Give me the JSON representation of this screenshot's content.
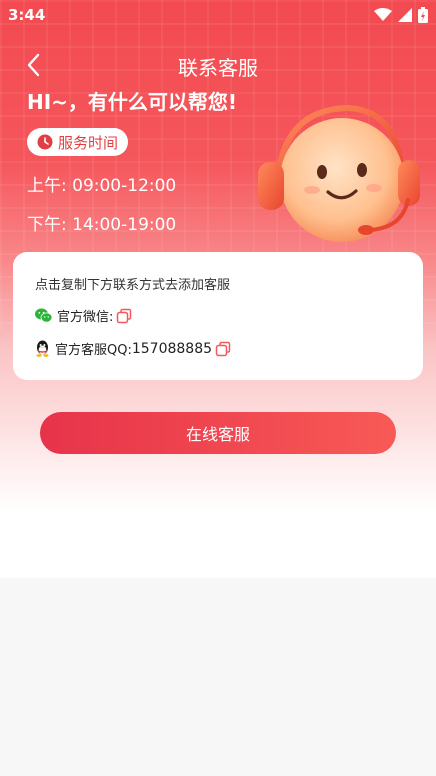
{
  "status_bar": {
    "time": "3:44"
  },
  "nav": {
    "title": "联系客服"
  },
  "greeting": "HI~，有什么可以帮您!",
  "service": {
    "badge": "服务时间",
    "morning": "上午: 09:00-12:00",
    "afternoon": "下午: 14:00-19:00"
  },
  "card": {
    "hint": "点击复制下方联系方式去添加客服",
    "wechat_label": "官方微信:",
    "wechat_value": "",
    "qq_label": "官方客服QQ:",
    "qq_value": "157088885"
  },
  "online_button": "在线客服",
  "colors": {
    "brand_red": "#f24a50",
    "button_start": "#e7334a",
    "button_end": "#f85a56"
  }
}
